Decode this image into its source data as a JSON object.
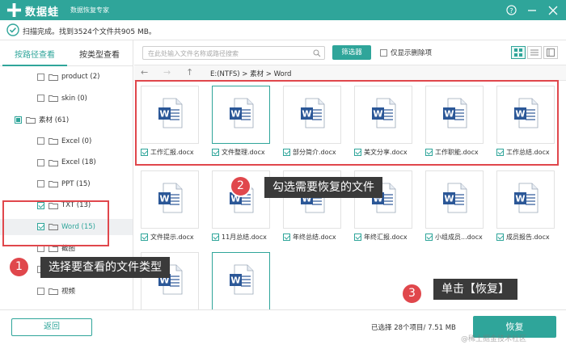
{
  "app": {
    "name": "数据蛙",
    "subtitle": "数据恢复专家"
  },
  "status": {
    "text": "扫描完成。找到3524个文件共905 MB。"
  },
  "left": {
    "tabs": [
      "按路径查看",
      "按类型查看"
    ],
    "tree": [
      {
        "label": "product (2)",
        "state": "off",
        "indent": 46
      },
      {
        "label": "skin (0)",
        "state": "off",
        "indent": 46
      },
      {
        "label": "素材 (61)",
        "state": "part",
        "indent": 18,
        "expand": "∨"
      },
      {
        "label": "Excel (0)",
        "state": "off",
        "indent": 46
      },
      {
        "label": "Excel (18)",
        "state": "off",
        "indent": 46
      },
      {
        "label": "PPT (15)",
        "state": "off",
        "indent": 46
      },
      {
        "label": "TXT (13)",
        "state": "on",
        "indent": 46
      },
      {
        "label": "Word (15)",
        "state": "on",
        "indent": 46,
        "selected": true
      },
      {
        "label": "截图",
        "state": "off",
        "indent": 46
      },
      {
        "label": "视频",
        "state": "off",
        "indent": 46
      },
      {
        "label": "视频",
        "state": "off",
        "indent": 46
      }
    ]
  },
  "toolbar": {
    "search_placeholder": "在此处输入文件名称或路径搜索",
    "filter_label": "筛选器",
    "only_deleted_label": "仅显示删除项"
  },
  "nav": {
    "path": "E:(NTFS) > 素材 > Word"
  },
  "files": [
    {
      "name": "工作汇报.docx",
      "checked": true
    },
    {
      "name": "文件整理.docx",
      "checked": true,
      "highlight": true
    },
    {
      "name": "部分简介.docx",
      "checked": true
    },
    {
      "name": "美文分享.docx",
      "checked": true
    },
    {
      "name": "工作职能.docx",
      "checked": true
    },
    {
      "name": "工作总结.docx",
      "checked": true
    },
    {
      "name": "文件提示.docx",
      "checked": true
    },
    {
      "name": "11月总结.docx",
      "checked": true
    },
    {
      "name": "年终总结.docx",
      "checked": true
    },
    {
      "name": "年终汇报.docx",
      "checked": true
    },
    {
      "name": "小组成员...docx",
      "checked": true
    },
    {
      "name": "成员报告.docx",
      "checked": true
    },
    {
      "name": "",
      "checked": true
    },
    {
      "name": "",
      "checked": true,
      "highlight": true
    }
  ],
  "callouts": {
    "one_num": "1",
    "one_text": "选择要查看的文件类型",
    "two_num": "2",
    "two_text": "勾选需要恢复的文件",
    "three_num": "3",
    "three_text": "单击【恢复】"
  },
  "bottom": {
    "back_label": "返回",
    "selection_info": "已选择 28个项目/ 7.51 MB",
    "recover_label": "恢复",
    "watermark": "@稀土掘金技术社区"
  },
  "colors": {
    "accent": "#2fa59a",
    "highlight_red": "#e0474c",
    "word_blue": "#2b5797"
  }
}
